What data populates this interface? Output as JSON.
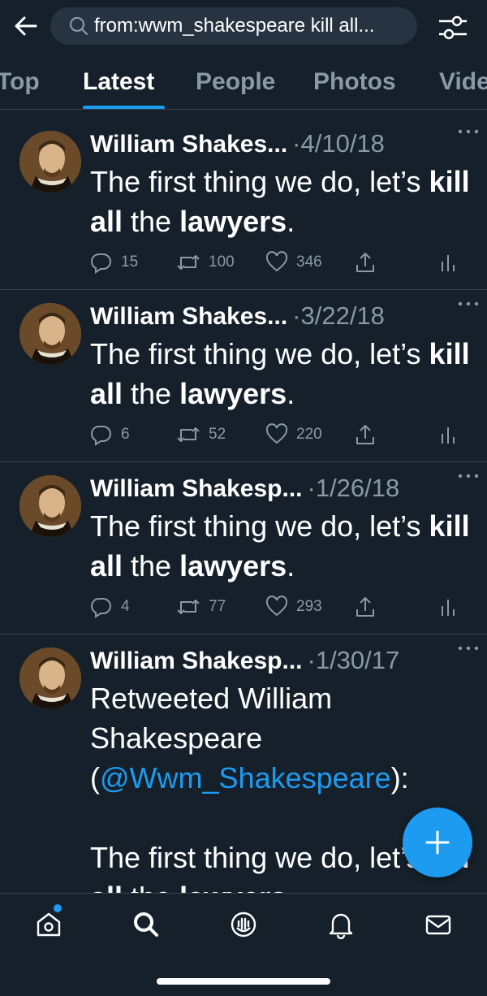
{
  "search": {
    "query": "from:wwm_shakespeare kill all..."
  },
  "tabs": [
    {
      "label": "Top",
      "active": false
    },
    {
      "label": "Latest",
      "active": true
    },
    {
      "label": "People",
      "active": false
    },
    {
      "label": "Photos",
      "active": false
    },
    {
      "label": "Videos",
      "active": false
    }
  ],
  "tweets": [
    {
      "name": "William Shakes...",
      "date": "·4/10/18",
      "body_parts": [
        "The first thing we do, let’s ",
        "kill all",
        " the ",
        "lawyers",
        "."
      ],
      "replies": "15",
      "retweets": "100",
      "likes": "346"
    },
    {
      "name": "William Shakes...",
      "date": "·3/22/18",
      "body_parts": [
        "The first thing we do, let’s ",
        "kill all",
        " the ",
        "lawyers",
        "."
      ],
      "replies": "6",
      "retweets": "52",
      "likes": "220"
    },
    {
      "name": "William Shakesp...",
      "date": "·1/26/18",
      "body_parts": [
        "The first thing we do, let’s ",
        "kill all",
        " the ",
        "lawyers",
        "."
      ],
      "replies": "4",
      "retweets": "77",
      "likes": "293"
    },
    {
      "name": "William Shakesp...",
      "date": "·1/30/17",
      "retweet_prefix": "Retweeted William Shakespeare (",
      "retweet_handle": "@Wwm_Shakespeare",
      "retweet_suffix": "):",
      "body_parts": [
        "The first thing we do, let’s ",
        "kill all",
        " the ",
        "lawyers",
        "."
      ]
    }
  ],
  "colors": {
    "background": "#15202b",
    "accent": "#1d9bf0",
    "muted": "#8b98a5",
    "divider": "#38444d"
  },
  "nav": [
    "home-icon",
    "search-icon",
    "spaces-icon",
    "notifications-icon",
    "messages-icon"
  ]
}
